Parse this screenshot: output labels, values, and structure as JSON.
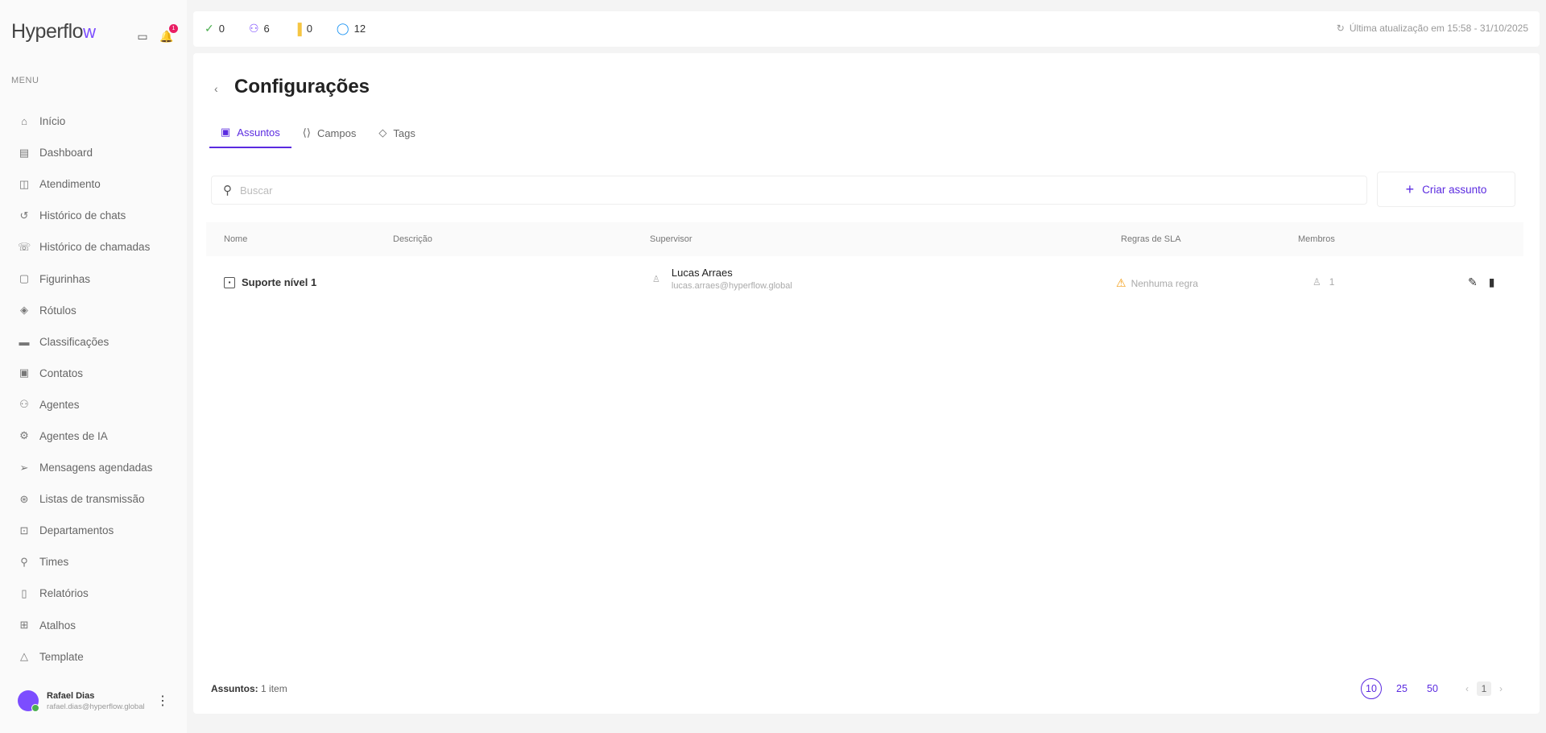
{
  "sidebar": {
    "logo": "Hyperflo",
    "logo_accent": "w",
    "notification_count": "1",
    "menu_title": "MENU",
    "items": [
      {
        "label": "Início",
        "icon": "home-icon"
      },
      {
        "label": "Dashboard",
        "icon": "dashboard-icon"
      },
      {
        "label": "Atendimento",
        "icon": "chat-icon"
      },
      {
        "label": "Histórico de chats",
        "icon": "history-icon"
      },
      {
        "label": "Histórico de chamadas",
        "icon": "phone-icon"
      },
      {
        "label": "Figurinhas",
        "icon": "sticker-icon"
      },
      {
        "label": "Rótulos",
        "icon": "tag-icon"
      },
      {
        "label": "Classificações",
        "icon": "folder-icon"
      },
      {
        "label": "Contatos",
        "icon": "contacts-icon"
      },
      {
        "label": "Agentes",
        "icon": "agents-icon"
      },
      {
        "label": "Agentes de IA",
        "icon": "ai-icon"
      },
      {
        "label": "Mensagens agendadas",
        "icon": "send-icon"
      },
      {
        "label": "Listas de transmissão",
        "icon": "broadcast-icon"
      },
      {
        "label": "Departamentos",
        "icon": "department-icon"
      },
      {
        "label": "Times",
        "icon": "team-icon"
      },
      {
        "label": "Relatórios",
        "icon": "report-icon"
      },
      {
        "label": "Atalhos",
        "icon": "shortcut-icon"
      },
      {
        "label": "Template",
        "icon": "template-icon"
      }
    ],
    "user": {
      "name": "Rafael Dias",
      "email": "rafael.dias@hyperflow.global"
    }
  },
  "topbar": {
    "stats": [
      {
        "icon": "check-circle-icon",
        "value": "0",
        "color": "#4caf50"
      },
      {
        "icon": "users-icon",
        "value": "6",
        "color": "#7c4dff"
      },
      {
        "icon": "flag-icon",
        "value": "0",
        "color": "#f5c542"
      },
      {
        "icon": "message-icon",
        "value": "12",
        "color": "#2196f3"
      }
    ],
    "last_update": "Última atualização em 15:58 - 31/10/2025"
  },
  "page": {
    "title": "Configurações",
    "tabs": [
      {
        "label": "Assuntos",
        "active": true
      },
      {
        "label": "Campos",
        "active": false
      },
      {
        "label": "Tags",
        "active": false
      }
    ],
    "search_placeholder": "Buscar",
    "create_label": "Criar assunto"
  },
  "table": {
    "columns": [
      "Nome",
      "Descrição",
      "Supervisor",
      "Regras de SLA",
      "Membros"
    ],
    "rows": [
      {
        "name": "Suporte nível 1",
        "description": "",
        "supervisor_name": "Lucas Arraes",
        "supervisor_email": "lucas.arraes@hyperflow.global",
        "sla": "Nenhuma regra",
        "members": "1"
      }
    ]
  },
  "footer": {
    "label": "Assuntos:",
    "count": "1 item",
    "page_sizes": [
      "10",
      "25",
      "50"
    ],
    "current_page": "1"
  },
  "colors": {
    "accent": "#5b2be0",
    "warning": "#f39c12"
  }
}
